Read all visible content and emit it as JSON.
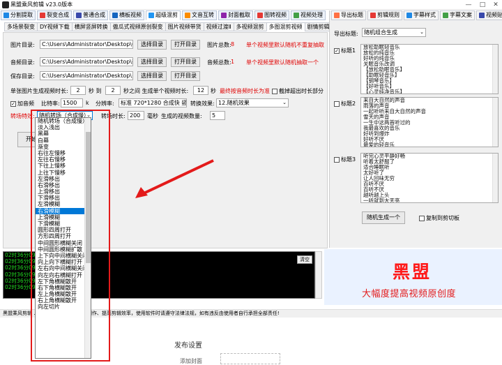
{
  "window": {
    "title": "黑盟乘风剪辑 v23.0版本",
    "controls": [
      "—",
      "□",
      "✕"
    ]
  },
  "toolbar": [
    {
      "label": "分割提取",
      "color": "#1e88e5"
    },
    {
      "label": "裂变合成",
      "color": "#e53935"
    },
    {
      "label": "普通合成",
      "color": "#3949ab"
    },
    {
      "label": "横板视频",
      "color": "#1565c0"
    },
    {
      "label": "超级混剪",
      "color": "#2196f3",
      "selected": true
    },
    {
      "label": "文音互转",
      "color": "#fb8c00"
    },
    {
      "label": "封面截取",
      "color": "#8e24aa"
    },
    {
      "label": "图转视频",
      "color": "#e53935"
    },
    {
      "label": "视频处理",
      "color": "#43a047"
    }
  ],
  "right_toolbar": [
    {
      "label": "导出标题",
      "color": "#ff7043"
    },
    {
      "label": "剪辑规则",
      "color": "#e53935"
    },
    {
      "label": "字幕样式",
      "color": "#1e88e5"
    },
    {
      "label": "字幕文案",
      "color": "#43a047"
    },
    {
      "label": "视频贴纸",
      "color": "#3949ab"
    }
  ],
  "subtabs": [
    "多场景裂变",
    "DY视频下载",
    "横屏竖屏转换",
    "傲瓜式视频原创裂变",
    "图片视频带货",
    "视频过渡Ⅱ",
    "多视频混剪",
    "多图混剪视频",
    "剧情剪辑"
  ],
  "subtab_selected": 7,
  "form": {
    "image_dir_label": "图片目录:",
    "image_dir_value": "C:\\Users\\Administrator\\Desktop\\69",
    "choose_label": "选择目录",
    "open_label": "打开目录",
    "image_total_label": "图片总数:",
    "image_total_value": "8",
    "image_note": "单个视频里默认随机不重复抽取",
    "audio_dir_label": "音频目录:",
    "audio_dir_value": "C:\\Users\\Administrator\\Desktop\\新",
    "audio_total_label": "音频总数:",
    "audio_total_value": "1",
    "audio_note": "单个视频里默认随机抽取一个",
    "save_dir_label": "保存目录:",
    "save_dir_value": "C:\\Users\\Administrator\\Desktop\\多",
    "duration_label": "单张图片生成视频时长:",
    "duration_from": "2",
    "to_label": "秒 到",
    "duration_to": "2",
    "gen_label": "秒之间 生成单个视频时长:",
    "single_duration": "12",
    "sec": "秒",
    "max_note": "最终按音频时长为准",
    "cut_check": "截掉超出时长部分",
    "add_audio": "加音频",
    "bitrate_label": "比特率:",
    "bitrate_value": "1500",
    "bitrate_unit": "k",
    "resolution_label": "分辨率:",
    "resolution_value": "标准 720*1280 合成快 竖版",
    "transition_label": "转换效果:",
    "transition_value": "12.随机效果",
    "effect_label": "转场特效:",
    "effect_value": "随机转场（合成慢）",
    "effect_time_label": "转场时长:",
    "effect_time_value": "200",
    "ms_label": "毫秒",
    "count_label": "生成的视频数量:",
    "count_value": "5",
    "start_label": "开始"
  },
  "dropdown": {
    "items": [
      "随机转场（合成慢）",
      "淡入浅出",
      "黑幕",
      "白幕",
      "渐变",
      "右往左慢移",
      "左往右慢移",
      "下往上慢移",
      "上往下慢移",
      "左滑移出",
      "右滑移出",
      "上滑移出",
      "下滑移出",
      "左滑模糊",
      "右滑模糊",
      "上滑模糊",
      "下滑模糊",
      "圆形四周打开",
      "方形四周打开",
      "中间圆形横糊关闭",
      "中间圆形模糊扩散",
      "上下向中间横糊关闭",
      "向上向下横糊打开",
      "左右向中间横糊关闭",
      "向左向右横糊打开",
      "左下角横糊散开",
      "右下角横糊散开",
      "左上角横糊散开",
      "右上角横糊散开",
      "向左切片"
    ],
    "highlighted": 14
  },
  "log": {
    "lines": [
      "02时36分09秒 ... 准备完毕",
      "02时36分09秒 ... 合成",
      "02时36分09秒 ... 成",
      "02时36分09秒 ...",
      "02时36分09秒 ...",
      "02时36分09秒 ... 全部执行完毕!"
    ],
    "clear_label": "清空"
  },
  "right": {
    "export_label": "导出标题:",
    "export_value": "随机组合生成",
    "title1_label": "标题1",
    "title1_checked": true,
    "title1_lines": [
      "放松助眠轻音乐",
      "放松的纯音乐",
      "好听的纯音乐",
      "关眠音乐改调",
      "【放松助眠音乐】",
      "【助眠轻音乐】",
      "【钢琴音乐】",
      "【好听音乐】",
      "【心灵纯净音乐】"
    ],
    "title2_label": "标题2",
    "title2_lines": [
      "来自大自然的声音",
      "雨落的声音",
      "一起听听来自大自然的声音",
      "雪天的声音",
      "一生中这两首听过的",
      "我最喜欢的音乐",
      "好听到爆炸",
      "好听不厌",
      "最爱的轻音乐"
    ],
    "title3_label": "标题3",
    "title3_lines": [
      "听完心灵平静好畅",
      "听着太舒服了",
      "适合睡眠听",
      "太好听了",
      "让人回味无穷",
      "百听不厌",
      "百听不厌",
      "越听越上头",
      "一听就到大天亮"
    ],
    "generate_label": "随机生成一个",
    "copy_label": "复制到剪切板"
  },
  "brand": {
    "name": "黑盟",
    "slogan": "大幅度提高视频原创度"
  },
  "status": "黑盟乘风剪辑 ...，仅用于个人原创视频制作、提高剪辑效率，使用软件时请遵守法律法规，如有违反由使用者自行承担全部责任!",
  "bottom": {
    "publish_label": "发布设置",
    "cover_label": "添加封面"
  }
}
